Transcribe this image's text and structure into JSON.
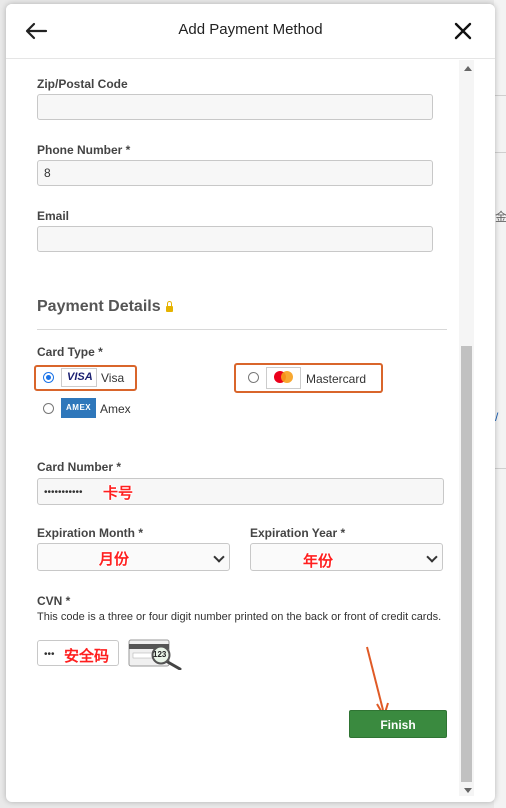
{
  "header": {
    "title": "Add Payment Method"
  },
  "fields": {
    "zip_label": "Zip/Postal Code",
    "zip_value": "",
    "phone_label": "Phone Number *",
    "phone_value": "8",
    "email_label": "Email",
    "email_value": ""
  },
  "payment": {
    "section_title": "Payment Details",
    "card_type_label": "Card Type *",
    "card_types": [
      {
        "label": "Visa",
        "logo_text": "VISA",
        "selected": true
      },
      {
        "label": "Mastercard",
        "selected": false
      },
      {
        "label": "Amex",
        "logo_text": "AMEX",
        "selected": false
      }
    ],
    "card_number_label": "Card Number *",
    "card_number_value": "•••••••••••",
    "exp_month_label": "Expiration Month *",
    "exp_month_value": "",
    "exp_year_label": "Expiration Year *",
    "exp_year_value": "",
    "cvn_label": "CVN *",
    "cvn_description": "This code is a three or four digit number printed on the back or front of credit cards.",
    "cvn_value": "•••",
    "cvn_card_digits": "123",
    "finish_label": "Finish"
  },
  "annotations": {
    "card_number": "卡号",
    "month": "月份",
    "year": "年份",
    "cvn": "安全码"
  },
  "colors": {
    "accent": "#1a73e8",
    "finish_button": "#3a8a3f",
    "annotation": "#ff1f1f",
    "highlight_box": "#d9652b"
  }
}
